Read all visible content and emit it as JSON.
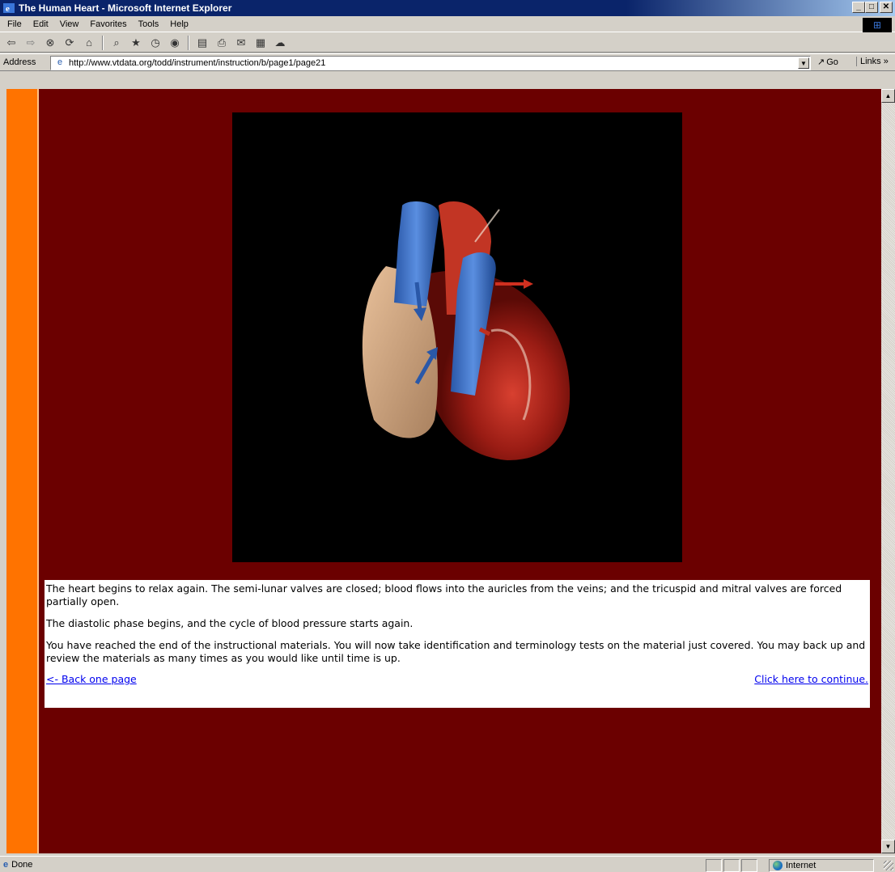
{
  "window": {
    "title": "The Human Heart - Microsoft Internet Explorer",
    "minimize": "_",
    "maximize": "□",
    "close": "✕"
  },
  "menu": {
    "items": [
      "File",
      "Edit",
      "View",
      "Favorites",
      "Tools",
      "Help"
    ]
  },
  "toolbar": {
    "icons": [
      "back-icon",
      "forward-icon",
      "stop-icon",
      "refresh-icon",
      "home-icon",
      "search-icon",
      "favorites-icon",
      "history-icon",
      "media-icon",
      "fullscreen-icon",
      "print-icon",
      "mail-icon",
      "edit-icon",
      "discuss-icon"
    ]
  },
  "address": {
    "label": "Address",
    "url": "http://www.vtdata.org/todd/instrument/instruction/b/page1/page21",
    "go_label": "Go",
    "links_label": "Links »"
  },
  "content": {
    "paragraphs": [
      "The heart begins to relax again. The semi-lunar valves are closed; blood flows into the auricles from the veins; and the tricuspid and mitral valves are forced partially open.",
      "The diastolic phase begins, and the cycle of blood pressure starts again.",
      "You have reached the end of the instructional materials. You will now take identification and terminology tests on the material just covered. You may back up and review the materials as many times as you would like until time is up."
    ],
    "back_link": "<- Back one page",
    "continue_link": "Click here to continue."
  },
  "status": {
    "text": "Done",
    "zone": "Internet"
  },
  "colors": {
    "page_background": "#6b0000",
    "left_stripe": "#ff7300",
    "link": "#0000ee"
  }
}
